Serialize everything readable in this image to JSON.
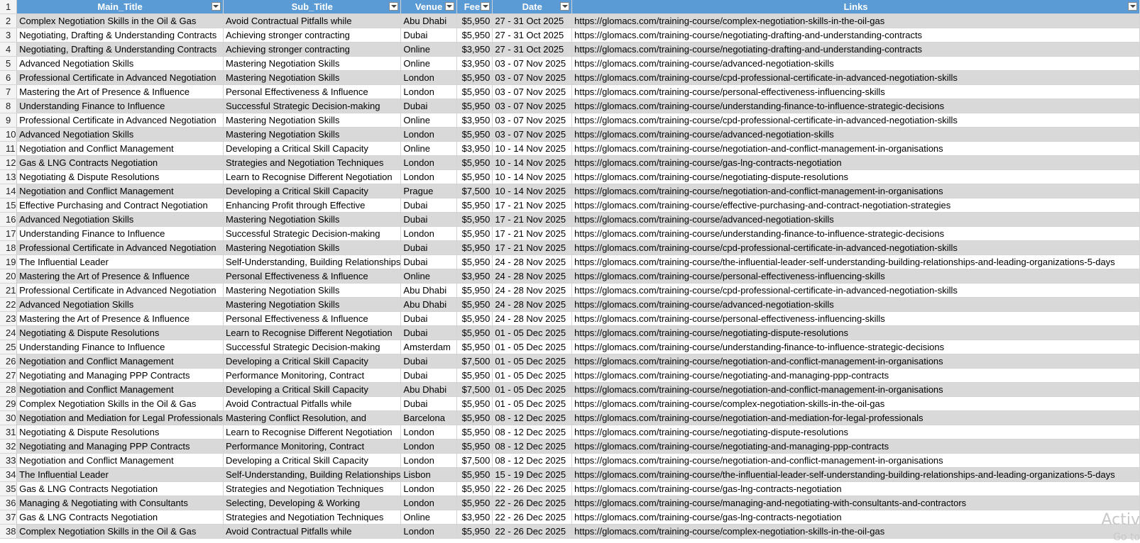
{
  "headers": [
    "Main_Title",
    "Sub_Title",
    "Venue",
    "Fees",
    "Date",
    "Links"
  ],
  "header_row_number": "1",
  "rows": [
    [
      "2",
      "Complex Negotiation Skills in the Oil & Gas",
      "Avoid Contractual Pitfalls while",
      "Abu Dhabi",
      "$5,950",
      "27 - 31 Oct 2025",
      "https://glomacs.com/training-course/complex-negotiation-skills-in-the-oil-gas"
    ],
    [
      "3",
      "Negotiating, Drafting & Understanding Contracts",
      "Achieving stronger contracting",
      "Dubai",
      "$5,950",
      "27 - 31 Oct 2025",
      "https://glomacs.com/training-course/negotiating-drafting-and-understanding-contracts"
    ],
    [
      "4",
      "Negotiating, Drafting & Understanding Contracts",
      "Achieving stronger contracting",
      "Online",
      "$3,950",
      "27 - 31 Oct 2025",
      "https://glomacs.com/training-course/negotiating-drafting-and-understanding-contracts"
    ],
    [
      "5",
      "Advanced Negotiation Skills",
      "Mastering Negotiation Skills",
      "Online",
      "$3,950",
      "03 - 07 Nov 2025",
      "https://glomacs.com/training-course/advanced-negotiation-skills"
    ],
    [
      "6",
      "Professional Certificate in Advanced Negotiation",
      "Mastering Negotiation Skills",
      "London",
      "$5,950",
      "03 - 07 Nov 2025",
      "https://glomacs.com/training-course/cpd-professional-certificate-in-advanced-negotiation-skills"
    ],
    [
      "7",
      "Mastering the Art of Presence & Influence",
      "Personal Effectiveness & Influence",
      "London",
      "$5,950",
      "03 - 07 Nov 2025",
      "https://glomacs.com/training-course/personal-effectiveness-influencing-skills"
    ],
    [
      "8",
      "Understanding Finance to Influence",
      "Successful Strategic Decision-making",
      "Dubai",
      "$5,950",
      "03 - 07 Nov 2025",
      "https://glomacs.com/training-course/understanding-finance-to-influence-strategic-decisions"
    ],
    [
      "9",
      "Professional Certificate in Advanced Negotiation",
      "Mastering Negotiation Skills",
      "Online",
      "$3,950",
      "03 - 07 Nov 2025",
      "https://glomacs.com/training-course/cpd-professional-certificate-in-advanced-negotiation-skills"
    ],
    [
      "10",
      "Advanced Negotiation Skills",
      "Mastering Negotiation Skills",
      "London",
      "$5,950",
      "03 - 07 Nov 2025",
      "https://glomacs.com/training-course/advanced-negotiation-skills"
    ],
    [
      "11",
      "Negotiation and Conflict Management",
      "Developing a Critical Skill Capacity",
      "Online",
      "$3,950",
      "10 - 14 Nov 2025",
      "https://glomacs.com/training-course/negotiation-and-conflict-management-in-organisations"
    ],
    [
      "12",
      "Gas & LNG Contracts Negotiation",
      "Strategies and Negotiation Techniques",
      "London",
      "$5,950",
      "10 - 14 Nov 2025",
      "https://glomacs.com/training-course/gas-lng-contracts-negotiation"
    ],
    [
      "13",
      "Negotiating & Dispute Resolutions",
      "Learn to Recognise Different Negotiation",
      "London",
      "$5,950",
      "10 - 14 Nov 2025",
      "https://glomacs.com/training-course/negotiating-dispute-resolutions"
    ],
    [
      "14",
      "Negotiation and Conflict Management",
      "Developing a Critical Skill Capacity",
      "Prague",
      "$7,500",
      "10 - 14 Nov 2025",
      "https://glomacs.com/training-course/negotiation-and-conflict-management-in-organisations"
    ],
    [
      "15",
      "Effective Purchasing and Contract Negotiation",
      "Enhancing Profit through Effective",
      "Dubai",
      "$5,950",
      "17 - 21 Nov 2025",
      "https://glomacs.com/training-course/effective-purchasing-and-contract-negotiation-strategies"
    ],
    [
      "16",
      "Advanced Negotiation Skills",
      "Mastering Negotiation Skills",
      "Dubai",
      "$5,950",
      "17 - 21 Nov 2025",
      "https://glomacs.com/training-course/advanced-negotiation-skills"
    ],
    [
      "17",
      "Understanding Finance to Influence",
      "Successful Strategic Decision-making",
      "London",
      "$5,950",
      "17 - 21 Nov 2025",
      "https://glomacs.com/training-course/understanding-finance-to-influence-strategic-decisions"
    ],
    [
      "18",
      "Professional Certificate in Advanced Negotiation",
      "Mastering Negotiation Skills",
      "Dubai",
      "$5,950",
      "17 - 21 Nov 2025",
      "https://glomacs.com/training-course/cpd-professional-certificate-in-advanced-negotiation-skills"
    ],
    [
      "19",
      "The Influential Leader",
      "Self-Understanding, Building Relationships",
      "Dubai",
      "$5,950",
      "24 - 28 Nov 2025",
      "https://glomacs.com/training-course/the-influential-leader-self-understanding-building-relationships-and-leading-organizations-5-days"
    ],
    [
      "20",
      "Mastering the Art of Presence & Influence",
      "Personal Effectiveness & Influence",
      "Online",
      "$3,950",
      "24 - 28 Nov 2025",
      "https://glomacs.com/training-course/personal-effectiveness-influencing-skills"
    ],
    [
      "21",
      "Professional Certificate in Advanced Negotiation",
      "Mastering Negotiation Skills",
      "Abu Dhabi",
      "$5,950",
      "24 - 28 Nov 2025",
      "https://glomacs.com/training-course/cpd-professional-certificate-in-advanced-negotiation-skills"
    ],
    [
      "22",
      "Advanced Negotiation Skills",
      "Mastering Negotiation Skills",
      "Abu Dhabi",
      "$5,950",
      "24 - 28 Nov 2025",
      "https://glomacs.com/training-course/advanced-negotiation-skills"
    ],
    [
      "23",
      "Mastering the Art of Presence & Influence",
      "Personal Effectiveness & Influence",
      "Dubai",
      "$5,950",
      "24 - 28 Nov 2025",
      "https://glomacs.com/training-course/personal-effectiveness-influencing-skills"
    ],
    [
      "24",
      "Negotiating & Dispute Resolutions",
      "Learn to Recognise Different Negotiation",
      "Dubai",
      "$5,950",
      "01 - 05 Dec 2025",
      "https://glomacs.com/training-course/negotiating-dispute-resolutions"
    ],
    [
      "25",
      "Understanding Finance to Influence",
      "Successful Strategic Decision-making",
      "Amsterdam",
      "$5,950",
      "01 - 05 Dec 2025",
      "https://glomacs.com/training-course/understanding-finance-to-influence-strategic-decisions"
    ],
    [
      "26",
      "Negotiation and Conflict Management",
      "Developing a Critical Skill Capacity",
      "Dubai",
      "$7,500",
      "01 - 05 Dec 2025",
      "https://glomacs.com/training-course/negotiation-and-conflict-management-in-organisations"
    ],
    [
      "27",
      "Negotiating and Managing PPP Contracts",
      "Performance Monitoring, Contract",
      "Dubai",
      "$5,950",
      "01 - 05 Dec 2025",
      "https://glomacs.com/training-course/negotiating-and-managing-ppp-contracts"
    ],
    [
      "28",
      "Negotiation and Conflict Management",
      "Developing a Critical Skill Capacity",
      "Abu Dhabi",
      "$7,500",
      "01 - 05 Dec 2025",
      "https://glomacs.com/training-course/negotiation-and-conflict-management-in-organisations"
    ],
    [
      "29",
      "Complex Negotiation Skills in the Oil & Gas",
      "Avoid Contractual Pitfalls while",
      "Dubai",
      "$5,950",
      "01 - 05 Dec 2025",
      "https://glomacs.com/training-course/complex-negotiation-skills-in-the-oil-gas"
    ],
    [
      "30",
      "Negotiation and Mediation for Legal Professionals",
      "Mastering Conflict Resolution, and",
      "Barcelona",
      "$5,950",
      "08 - 12 Dec 2025",
      "https://glomacs.com/training-course/negotiation-and-mediation-for-legal-professionals"
    ],
    [
      "31",
      "Negotiating & Dispute Resolutions",
      "Learn to Recognise Different Negotiation",
      "London",
      "$5,950",
      "08 - 12 Dec 2025",
      "https://glomacs.com/training-course/negotiating-dispute-resolutions"
    ],
    [
      "32",
      "Negotiating and Managing PPP Contracts",
      "Performance Monitoring, Contract",
      "London",
      "$5,950",
      "08 - 12 Dec 2025",
      "https://glomacs.com/training-course/negotiating-and-managing-ppp-contracts"
    ],
    [
      "33",
      "Negotiation and Conflict Management",
      "Developing a Critical Skill Capacity",
      "London",
      "$7,500",
      "08 - 12 Dec 2025",
      "https://glomacs.com/training-course/negotiation-and-conflict-management-in-organisations"
    ],
    [
      "34",
      "The Influential Leader",
      "Self-Understanding, Building Relationships",
      "Lisbon",
      "$5,950",
      "15 - 19 Dec 2025",
      "https://glomacs.com/training-course/the-influential-leader-self-understanding-building-relationships-and-leading-organizations-5-days"
    ],
    [
      "35",
      "Gas & LNG Contracts Negotiation",
      "Strategies and Negotiation Techniques",
      "London",
      "$5,950",
      "22 - 26 Dec 2025",
      "https://glomacs.com/training-course/gas-lng-contracts-negotiation"
    ],
    [
      "36",
      "Managing & Negotiating with Consultants",
      "Selecting, Developing & Working",
      "London",
      "$5,950",
      "22 - 26 Dec 2025",
      "https://glomacs.com/training-course/managing-and-negotiating-with-consultants-and-contractors"
    ],
    [
      "37",
      "Gas & LNG Contracts Negotiation",
      "Strategies and Negotiation Techniques",
      "Online",
      "$3,950",
      "22 - 26 Dec 2025",
      "https://glomacs.com/training-course/gas-lng-contracts-negotiation"
    ],
    [
      "38",
      "Complex Negotiation Skills in the Oil & Gas",
      "Avoid Contractual Pitfalls while",
      "London",
      "$5,950",
      "22 - 26 Dec 2025",
      "https://glomacs.com/training-course/complex-negotiation-skills-in-the-oil-gas"
    ]
  ],
  "watermark": {
    "line1": "Activ",
    "line2": "Go to"
  },
  "colors": {
    "header": "#5b9bd5",
    "band": "#d9d9d9"
  }
}
